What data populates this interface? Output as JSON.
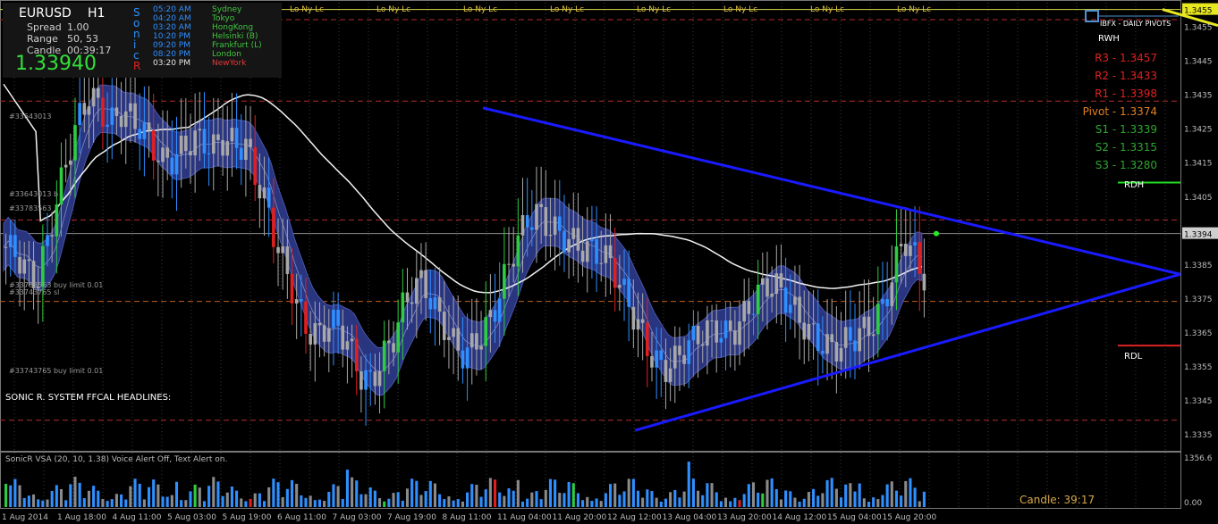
{
  "panel": {
    "symbol": "EURUSD",
    "timeframe": "H1",
    "spread_label": "Spread",
    "spread_value": "1.00",
    "range_label": "Range",
    "range_value": "50, 53",
    "candle_label": "Candle",
    "candle_value": "00:39:17",
    "price": "1.33940",
    "sonic_letters": [
      "S",
      "o",
      "n",
      "i",
      "c",
      "R"
    ],
    "sessions": [
      {
        "time": "05:20 AM",
        "city": "Sydney"
      },
      {
        "time": "04:20 AM",
        "city": "Tokyo"
      },
      {
        "time": "03:20 AM",
        "city": "HongKong"
      },
      {
        "time": "10:20 PM",
        "city": "Helsinki (B)"
      },
      {
        "time": "09:20 PM",
        "city": "Frankfurt (L)"
      },
      {
        "time": "08:20 PM",
        "city": "London"
      },
      {
        "time": "03:20 PM",
        "city": "NewYork"
      }
    ]
  },
  "session_marker": "Lo   Ny  Lc",
  "brand": "IBFX - DAILY PIVOTS",
  "pivots": [
    {
      "label": "RWH",
      "color": "#ffffff"
    },
    {
      "label": "R3 - 1.3457",
      "color": "#e02020"
    },
    {
      "label": "R2 - 1.3433",
      "color": "#e02020"
    },
    {
      "label": "R1 - 1.3398",
      "color": "#e02020"
    },
    {
      "label": "Pivot - 1.3374",
      "color": "#e08020"
    },
    {
      "label": "S1 - 1.3339",
      "color": "#2ea52e"
    },
    {
      "label": "S2 - 1.3315",
      "color": "#2ea52e"
    },
    {
      "label": "S3 - 1.3280",
      "color": "#2ea52e"
    }
  ],
  "rdh": "RDH",
  "rdl": "RDL",
  "orders": [
    "#33643013",
    "#33643013 b",
    "#33783563",
    "#33783563 buy limit 0.01",
    "#33743765 sl",
    "#33743765 buy limit 0.01"
  ],
  "headlines": "SONIC R. SYSTEM  FFCAL HEADLINES:",
  "indicator_label": "SonicR VSA (20, 10, 1.38)  Voice Alert Off, Text Alert on.",
  "candle_timer": "Candle:  39:17",
  "price_axis": [
    "1.3455",
    "1.3445",
    "1.3435",
    "1.3425",
    "1.3415",
    "1.3405",
    "1.3394",
    "1.3385",
    "1.3375",
    "1.3365",
    "1.3355",
    "1.3345",
    "1.3335"
  ],
  "volume_axis": [
    "1356.6",
    "0.00"
  ],
  "time_axis": [
    "1 Aug 2014",
    "1 Aug 18:00",
    "4 Aug 11:00",
    "5 Aug 03:00",
    "5 Aug 19:00",
    "6 Aug 11:00",
    "7 Aug 03:00",
    "7 Aug 19:00",
    "8 Aug 11:00",
    "11 Aug 04:00",
    "11 Aug 20:00",
    "12 Aug 12:00",
    "13 Aug 04:00",
    "13 Aug 20:00",
    "14 Aug 12:00",
    "15 Aug 04:00",
    "15 Aug 20:00"
  ],
  "chart_data": {
    "type": "candlestick",
    "ylim": [
      1.333,
      1.3462
    ],
    "current_price": 1.3394,
    "close_path": [
      1.339,
      1.3388,
      1.3383,
      1.338,
      1.3392,
      1.3405,
      1.3418,
      1.3428,
      1.3435,
      1.3431,
      1.3426,
      1.343,
      1.3428,
      1.3425,
      1.342,
      1.3415,
      1.3416,
      1.3419,
      1.3422,
      1.3421,
      1.3419,
      1.3422,
      1.342,
      1.342,
      1.341,
      1.3402,
      1.339,
      1.3382,
      1.3372,
      1.3365,
      1.3364,
      1.3368,
      1.3366,
      1.336,
      1.3352,
      1.335,
      1.3357,
      1.3362,
      1.3372,
      1.3378,
      1.338,
      1.3372,
      1.3367,
      1.3361,
      1.3358,
      1.3362,
      1.3366,
      1.3373,
      1.3383,
      1.3392,
      1.3398,
      1.34,
      1.3396,
      1.3394,
      1.3392,
      1.339,
      1.3389,
      1.3388,
      1.3385,
      1.3378,
      1.3371,
      1.3364,
      1.3357,
      1.3354,
      1.3356,
      1.336,
      1.3363,
      1.3365,
      1.3366,
      1.3364,
      1.3366,
      1.3371,
      1.3376,
      1.3379,
      1.3378,
      1.3374,
      1.3369,
      1.3365,
      1.3362,
      1.336,
      1.3361,
      1.3363,
      1.3365,
      1.3367,
      1.3372,
      1.3382,
      1.3393,
      1.3388,
      1.3381
    ],
    "trendlines": [
      {
        "name": "upper",
        "from": [
          "8 Aug 11:00",
          1.3431
        ],
        "to": [
          "right",
          1.3382
        ]
      },
      {
        "name": "lower",
        "from": [
          "12 Aug 04:00",
          1.3336
        ],
        "to": [
          "right",
          1.3382
        ]
      }
    ]
  }
}
